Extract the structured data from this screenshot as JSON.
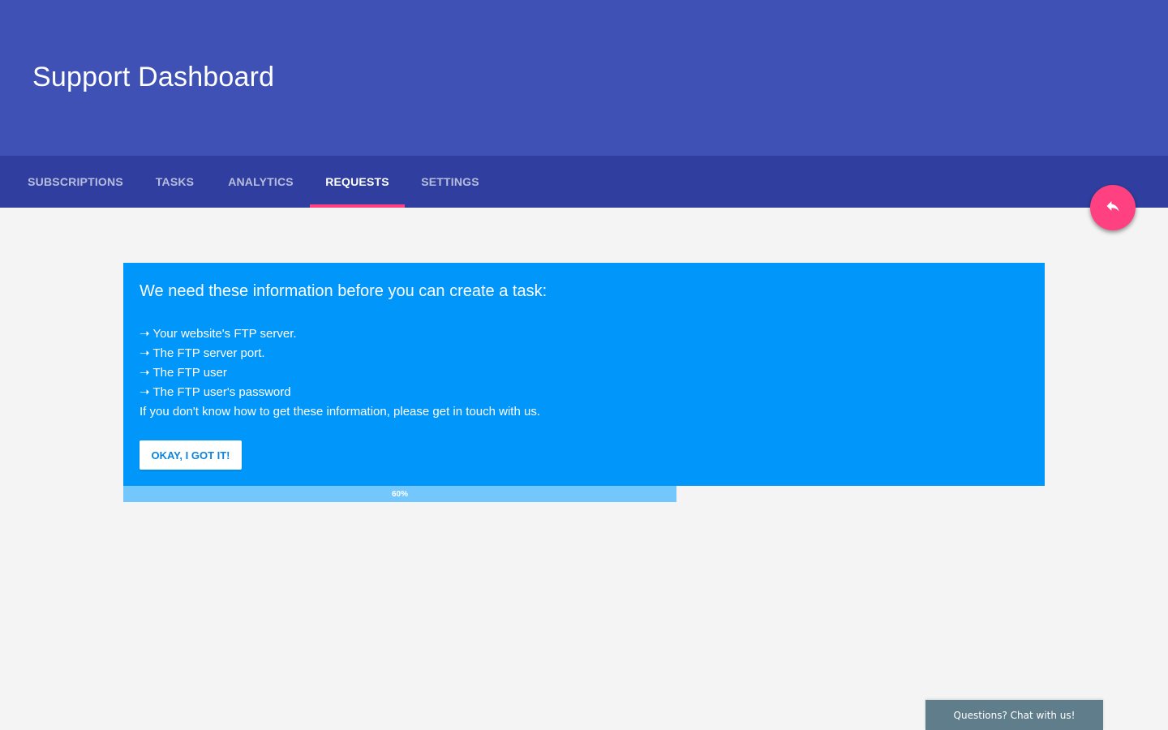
{
  "header": {
    "title": "Support Dashboard"
  },
  "tabs": [
    {
      "label": "SUBSCRIPTIONS",
      "active": false
    },
    {
      "label": "TASKS",
      "active": false
    },
    {
      "label": "ANALYTICS",
      "active": false
    },
    {
      "label": "REQUESTS",
      "active": true
    },
    {
      "label": "SETTINGS",
      "active": false
    }
  ],
  "fab": {
    "icon": "reply-icon",
    "color": "#ff4081"
  },
  "info_card": {
    "title": "We need these information before you can create a task:",
    "items": [
      "➝ Your website's FTP server.",
      "➝ The FTP server port.",
      "➝ The FTP user",
      "➝ The FTP user's password"
    ],
    "note": "If you don't know how to get these information, please get in touch with us.",
    "button_label": "OKAY, I GOT IT!",
    "color": "#0096fa"
  },
  "progress": {
    "value": 0.6,
    "label": "60%"
  },
  "chat": {
    "label": "Questions? Chat with us!"
  },
  "colors": {
    "header": "#3f51b5",
    "tabbar": "#303f9f",
    "accent": "#ff4081"
  }
}
